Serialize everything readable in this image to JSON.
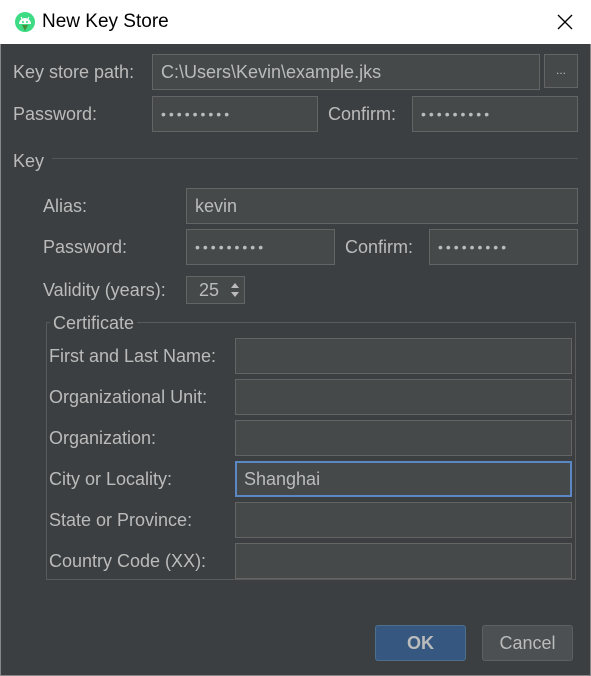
{
  "window": {
    "title": "New Key Store"
  },
  "keystore": {
    "path_label": "Key store path:",
    "path_value": "C:\\Users\\Kevin\\example.jks",
    "browse_label": "...",
    "password_label": "Password:",
    "password_value": "•••••••••",
    "confirm_label": "Confirm:",
    "confirm_value": "•••••••••"
  },
  "key": {
    "section_label": "Key",
    "alias_label": "Alias:",
    "alias_value": "kevin",
    "password_label": "Password:",
    "password_value": "•••••••••",
    "confirm_label": "Confirm:",
    "confirm_value": "•••••••••",
    "validity_label": "Validity (years):",
    "validity_value": "25"
  },
  "certificate": {
    "title": "Certificate",
    "fields": [
      {
        "label": "First and Last Name:",
        "value": ""
      },
      {
        "label": "Organizational Unit:",
        "value": ""
      },
      {
        "label": "Organization:",
        "value": ""
      },
      {
        "label": "City or Locality:",
        "value": "Shanghai"
      },
      {
        "label": "State or Province:",
        "value": ""
      },
      {
        "label": "Country Code (XX):",
        "value": ""
      }
    ]
  },
  "buttons": {
    "ok": "OK",
    "cancel": "Cancel"
  },
  "colors": {
    "background": "#3c3f41",
    "field": "#45494a",
    "focus": "#5b88c4",
    "ok_button": "#365880"
  }
}
